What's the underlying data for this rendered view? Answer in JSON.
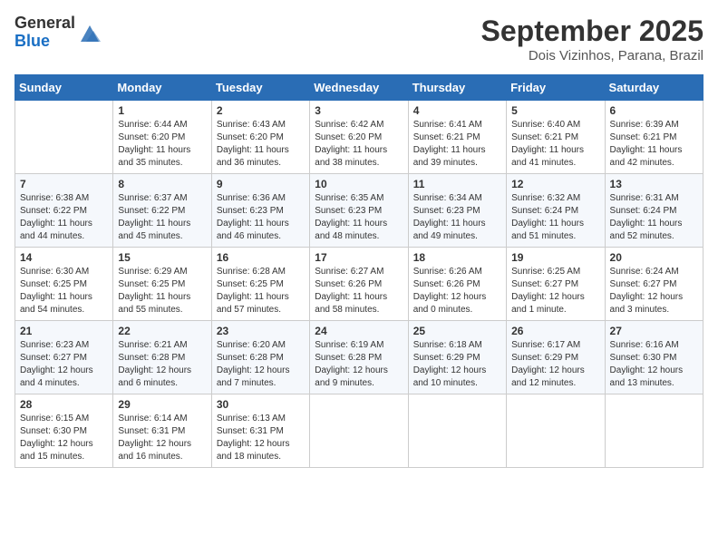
{
  "header": {
    "logo_general": "General",
    "logo_blue": "Blue",
    "month_title": "September 2025",
    "location": "Dois Vizinhos, Parana, Brazil"
  },
  "days_of_week": [
    "Sunday",
    "Monday",
    "Tuesday",
    "Wednesday",
    "Thursday",
    "Friday",
    "Saturday"
  ],
  "weeks": [
    [
      {
        "day": "",
        "info": ""
      },
      {
        "day": "1",
        "info": "Sunrise: 6:44 AM\nSunset: 6:20 PM\nDaylight: 11 hours\nand 35 minutes."
      },
      {
        "day": "2",
        "info": "Sunrise: 6:43 AM\nSunset: 6:20 PM\nDaylight: 11 hours\nand 36 minutes."
      },
      {
        "day": "3",
        "info": "Sunrise: 6:42 AM\nSunset: 6:20 PM\nDaylight: 11 hours\nand 38 minutes."
      },
      {
        "day": "4",
        "info": "Sunrise: 6:41 AM\nSunset: 6:21 PM\nDaylight: 11 hours\nand 39 minutes."
      },
      {
        "day": "5",
        "info": "Sunrise: 6:40 AM\nSunset: 6:21 PM\nDaylight: 11 hours\nand 41 minutes."
      },
      {
        "day": "6",
        "info": "Sunrise: 6:39 AM\nSunset: 6:21 PM\nDaylight: 11 hours\nand 42 minutes."
      }
    ],
    [
      {
        "day": "7",
        "info": "Sunrise: 6:38 AM\nSunset: 6:22 PM\nDaylight: 11 hours\nand 44 minutes."
      },
      {
        "day": "8",
        "info": "Sunrise: 6:37 AM\nSunset: 6:22 PM\nDaylight: 11 hours\nand 45 minutes."
      },
      {
        "day": "9",
        "info": "Sunrise: 6:36 AM\nSunset: 6:23 PM\nDaylight: 11 hours\nand 46 minutes."
      },
      {
        "day": "10",
        "info": "Sunrise: 6:35 AM\nSunset: 6:23 PM\nDaylight: 11 hours\nand 48 minutes."
      },
      {
        "day": "11",
        "info": "Sunrise: 6:34 AM\nSunset: 6:23 PM\nDaylight: 11 hours\nand 49 minutes."
      },
      {
        "day": "12",
        "info": "Sunrise: 6:32 AM\nSunset: 6:24 PM\nDaylight: 11 hours\nand 51 minutes."
      },
      {
        "day": "13",
        "info": "Sunrise: 6:31 AM\nSunset: 6:24 PM\nDaylight: 11 hours\nand 52 minutes."
      }
    ],
    [
      {
        "day": "14",
        "info": "Sunrise: 6:30 AM\nSunset: 6:25 PM\nDaylight: 11 hours\nand 54 minutes."
      },
      {
        "day": "15",
        "info": "Sunrise: 6:29 AM\nSunset: 6:25 PM\nDaylight: 11 hours\nand 55 minutes."
      },
      {
        "day": "16",
        "info": "Sunrise: 6:28 AM\nSunset: 6:25 PM\nDaylight: 11 hours\nand 57 minutes."
      },
      {
        "day": "17",
        "info": "Sunrise: 6:27 AM\nSunset: 6:26 PM\nDaylight: 11 hours\nand 58 minutes."
      },
      {
        "day": "18",
        "info": "Sunrise: 6:26 AM\nSunset: 6:26 PM\nDaylight: 12 hours\nand 0 minutes."
      },
      {
        "day": "19",
        "info": "Sunrise: 6:25 AM\nSunset: 6:27 PM\nDaylight: 12 hours\nand 1 minute."
      },
      {
        "day": "20",
        "info": "Sunrise: 6:24 AM\nSunset: 6:27 PM\nDaylight: 12 hours\nand 3 minutes."
      }
    ],
    [
      {
        "day": "21",
        "info": "Sunrise: 6:23 AM\nSunset: 6:27 PM\nDaylight: 12 hours\nand 4 minutes."
      },
      {
        "day": "22",
        "info": "Sunrise: 6:21 AM\nSunset: 6:28 PM\nDaylight: 12 hours\nand 6 minutes."
      },
      {
        "day": "23",
        "info": "Sunrise: 6:20 AM\nSunset: 6:28 PM\nDaylight: 12 hours\nand 7 minutes."
      },
      {
        "day": "24",
        "info": "Sunrise: 6:19 AM\nSunset: 6:28 PM\nDaylight: 12 hours\nand 9 minutes."
      },
      {
        "day": "25",
        "info": "Sunrise: 6:18 AM\nSunset: 6:29 PM\nDaylight: 12 hours\nand 10 minutes."
      },
      {
        "day": "26",
        "info": "Sunrise: 6:17 AM\nSunset: 6:29 PM\nDaylight: 12 hours\nand 12 minutes."
      },
      {
        "day": "27",
        "info": "Sunrise: 6:16 AM\nSunset: 6:30 PM\nDaylight: 12 hours\nand 13 minutes."
      }
    ],
    [
      {
        "day": "28",
        "info": "Sunrise: 6:15 AM\nSunset: 6:30 PM\nDaylight: 12 hours\nand 15 minutes."
      },
      {
        "day": "29",
        "info": "Sunrise: 6:14 AM\nSunset: 6:31 PM\nDaylight: 12 hours\nand 16 minutes."
      },
      {
        "day": "30",
        "info": "Sunrise: 6:13 AM\nSunset: 6:31 PM\nDaylight: 12 hours\nand 18 minutes."
      },
      {
        "day": "",
        "info": ""
      },
      {
        "day": "",
        "info": ""
      },
      {
        "day": "",
        "info": ""
      },
      {
        "day": "",
        "info": ""
      }
    ]
  ]
}
